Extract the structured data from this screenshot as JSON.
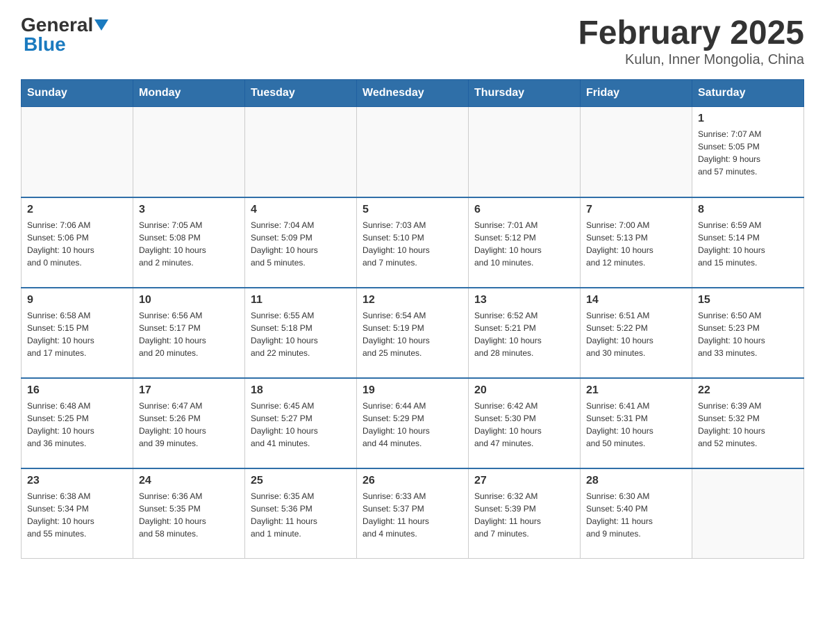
{
  "header": {
    "logo_general": "General",
    "logo_blue": "Blue",
    "title": "February 2025",
    "subtitle": "Kulun, Inner Mongolia, China"
  },
  "days_of_week": [
    "Sunday",
    "Monday",
    "Tuesday",
    "Wednesday",
    "Thursday",
    "Friday",
    "Saturday"
  ],
  "weeks": [
    {
      "days": [
        {
          "number": "",
          "info": ""
        },
        {
          "number": "",
          "info": ""
        },
        {
          "number": "",
          "info": ""
        },
        {
          "number": "",
          "info": ""
        },
        {
          "number": "",
          "info": ""
        },
        {
          "number": "",
          "info": ""
        },
        {
          "number": "1",
          "info": "Sunrise: 7:07 AM\nSunset: 5:05 PM\nDaylight: 9 hours\nand 57 minutes."
        }
      ]
    },
    {
      "days": [
        {
          "number": "2",
          "info": "Sunrise: 7:06 AM\nSunset: 5:06 PM\nDaylight: 10 hours\nand 0 minutes."
        },
        {
          "number": "3",
          "info": "Sunrise: 7:05 AM\nSunset: 5:08 PM\nDaylight: 10 hours\nand 2 minutes."
        },
        {
          "number": "4",
          "info": "Sunrise: 7:04 AM\nSunset: 5:09 PM\nDaylight: 10 hours\nand 5 minutes."
        },
        {
          "number": "5",
          "info": "Sunrise: 7:03 AM\nSunset: 5:10 PM\nDaylight: 10 hours\nand 7 minutes."
        },
        {
          "number": "6",
          "info": "Sunrise: 7:01 AM\nSunset: 5:12 PM\nDaylight: 10 hours\nand 10 minutes."
        },
        {
          "number": "7",
          "info": "Sunrise: 7:00 AM\nSunset: 5:13 PM\nDaylight: 10 hours\nand 12 minutes."
        },
        {
          "number": "8",
          "info": "Sunrise: 6:59 AM\nSunset: 5:14 PM\nDaylight: 10 hours\nand 15 minutes."
        }
      ]
    },
    {
      "days": [
        {
          "number": "9",
          "info": "Sunrise: 6:58 AM\nSunset: 5:15 PM\nDaylight: 10 hours\nand 17 minutes."
        },
        {
          "number": "10",
          "info": "Sunrise: 6:56 AM\nSunset: 5:17 PM\nDaylight: 10 hours\nand 20 minutes."
        },
        {
          "number": "11",
          "info": "Sunrise: 6:55 AM\nSunset: 5:18 PM\nDaylight: 10 hours\nand 22 minutes."
        },
        {
          "number": "12",
          "info": "Sunrise: 6:54 AM\nSunset: 5:19 PM\nDaylight: 10 hours\nand 25 minutes."
        },
        {
          "number": "13",
          "info": "Sunrise: 6:52 AM\nSunset: 5:21 PM\nDaylight: 10 hours\nand 28 minutes."
        },
        {
          "number": "14",
          "info": "Sunrise: 6:51 AM\nSunset: 5:22 PM\nDaylight: 10 hours\nand 30 minutes."
        },
        {
          "number": "15",
          "info": "Sunrise: 6:50 AM\nSunset: 5:23 PM\nDaylight: 10 hours\nand 33 minutes."
        }
      ]
    },
    {
      "days": [
        {
          "number": "16",
          "info": "Sunrise: 6:48 AM\nSunset: 5:25 PM\nDaylight: 10 hours\nand 36 minutes."
        },
        {
          "number": "17",
          "info": "Sunrise: 6:47 AM\nSunset: 5:26 PM\nDaylight: 10 hours\nand 39 minutes."
        },
        {
          "number": "18",
          "info": "Sunrise: 6:45 AM\nSunset: 5:27 PM\nDaylight: 10 hours\nand 41 minutes."
        },
        {
          "number": "19",
          "info": "Sunrise: 6:44 AM\nSunset: 5:29 PM\nDaylight: 10 hours\nand 44 minutes."
        },
        {
          "number": "20",
          "info": "Sunrise: 6:42 AM\nSunset: 5:30 PM\nDaylight: 10 hours\nand 47 minutes."
        },
        {
          "number": "21",
          "info": "Sunrise: 6:41 AM\nSunset: 5:31 PM\nDaylight: 10 hours\nand 50 minutes."
        },
        {
          "number": "22",
          "info": "Sunrise: 6:39 AM\nSunset: 5:32 PM\nDaylight: 10 hours\nand 52 minutes."
        }
      ]
    },
    {
      "days": [
        {
          "number": "23",
          "info": "Sunrise: 6:38 AM\nSunset: 5:34 PM\nDaylight: 10 hours\nand 55 minutes."
        },
        {
          "number": "24",
          "info": "Sunrise: 6:36 AM\nSunset: 5:35 PM\nDaylight: 10 hours\nand 58 minutes."
        },
        {
          "number": "25",
          "info": "Sunrise: 6:35 AM\nSunset: 5:36 PM\nDaylight: 11 hours\nand 1 minute."
        },
        {
          "number": "26",
          "info": "Sunrise: 6:33 AM\nSunset: 5:37 PM\nDaylight: 11 hours\nand 4 minutes."
        },
        {
          "number": "27",
          "info": "Sunrise: 6:32 AM\nSunset: 5:39 PM\nDaylight: 11 hours\nand 7 minutes."
        },
        {
          "number": "28",
          "info": "Sunrise: 6:30 AM\nSunset: 5:40 PM\nDaylight: 11 hours\nand 9 minutes."
        },
        {
          "number": "",
          "info": ""
        }
      ]
    }
  ]
}
